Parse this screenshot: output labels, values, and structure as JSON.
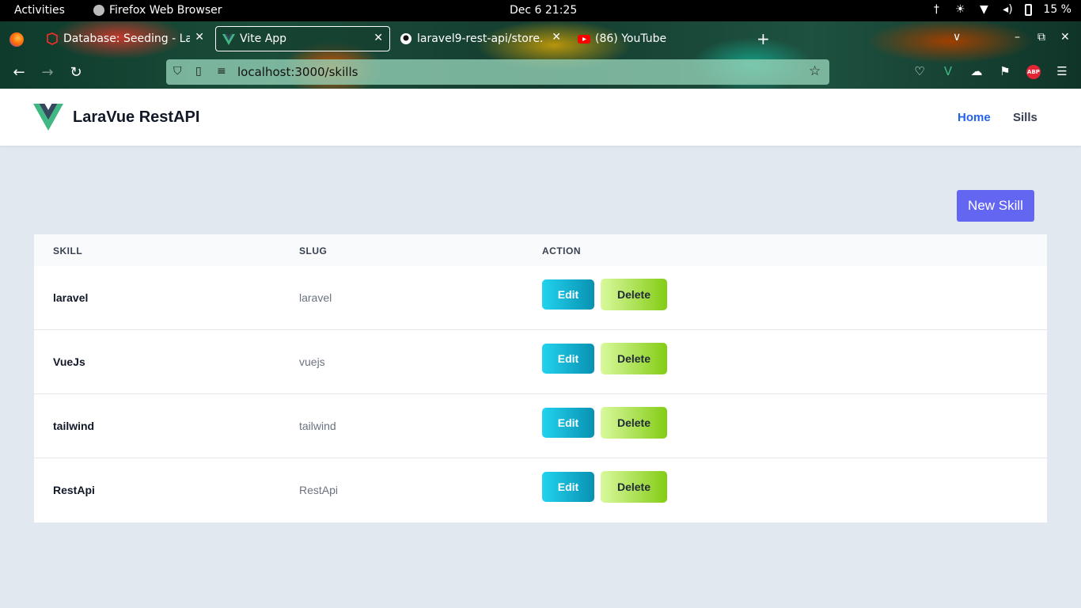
{
  "system": {
    "activities": "Activities",
    "app_name": "Firefox Web Browser",
    "clock": "Dec 6  21:25",
    "battery": "15 %",
    "tray_icons": [
      "accessibility-icon",
      "brightness-icon",
      "wifi-icon",
      "volume-icon",
      "battery-icon"
    ]
  },
  "browser": {
    "tabs": [
      {
        "title": "Database: Seeding - Lara",
        "icon": "laravel-icon",
        "active": false
      },
      {
        "title": "Vite App",
        "icon": "vue-icon",
        "active": true
      },
      {
        "title": "laravel9-rest-api/store.",
        "icon": "github-icon",
        "active": false
      },
      {
        "title": "(86) YouTube",
        "icon": "youtube-icon",
        "active": false
      }
    ],
    "url": "localhost:3000/skills",
    "abp_label": "ABP"
  },
  "app": {
    "brand": "LaraVue RestAPI",
    "brand_color": "#41b883",
    "nav": {
      "home": "Home",
      "sills": "Sills"
    },
    "new_skill_label": "New Skill",
    "accent_color": "#6366f1",
    "table": {
      "headers": {
        "skill": "SKILL",
        "slug": "SLUG",
        "action": "ACTION"
      },
      "edit_label": "Edit",
      "delete_label": "Delete",
      "rows": [
        {
          "skill": "laravel",
          "slug": "laravel"
        },
        {
          "skill": "VueJs",
          "slug": "vuejs"
        },
        {
          "skill": "tailwind",
          "slug": "tailwind"
        },
        {
          "skill": "RestApi",
          "slug": "RestApi"
        }
      ]
    }
  }
}
